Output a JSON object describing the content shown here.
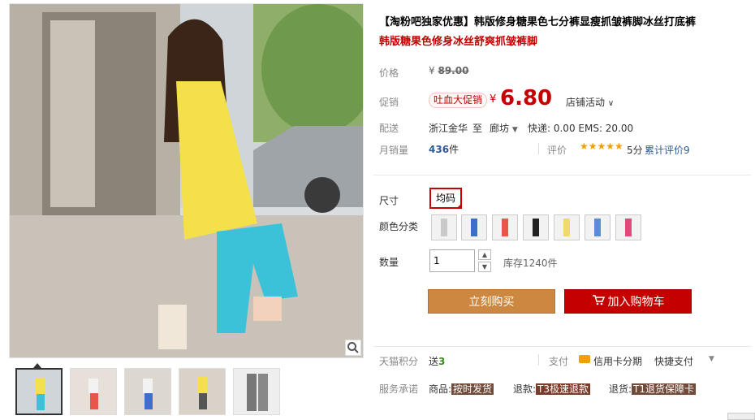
{
  "product": {
    "title": "【淘粉吧独家优惠】韩版修身糖果色七分裤显瘦抓皱裤脚冰丝打底裤",
    "subtitle": "韩版糖果色修身冰丝舒爽抓皱裤脚"
  },
  "price": {
    "label": "价格",
    "currency": "¥",
    "original": "89.00",
    "promo_label": "促销",
    "promo_badge": "吐血大促销",
    "promo_price": "6.80",
    "store_activity": "店铺活动"
  },
  "shipping": {
    "label": "配送",
    "from": "浙江金华",
    "to_word": "至",
    "to": "廊坊",
    "info": "快递: 0.00 EMS: 20.00"
  },
  "sales": {
    "label": "月销量",
    "count": "436",
    "unit": "件",
    "rating_label": "评价",
    "stars": "★★★★★",
    "score": "5分",
    "reviews": "累计评价9"
  },
  "size": {
    "label": "尺寸",
    "value": "均码"
  },
  "color": {
    "label": "颜色分类",
    "swatches": [
      "#c9c9c9",
      "#3b6fc9",
      "#e8554a",
      "#222222",
      "#f0d96a",
      "#5a8ad8",
      "#e04a7a"
    ]
  },
  "quantity": {
    "label": "数量",
    "value": "1",
    "stock": "库存1240件"
  },
  "buttons": {
    "buy": "立刻购买",
    "cart": "加入购物车"
  },
  "points": {
    "label": "天猫积分",
    "send": "送",
    "amount": "3",
    "pay_label": "支付",
    "credit": "信用卡分期",
    "quick": "快捷支付"
  },
  "service": {
    "label": "服务承诺",
    "goods": "商品:",
    "goods_tag": "按时发货",
    "refund": "退款:",
    "refund_tag": "T3极速退款",
    "return": "退货:",
    "return_tag": "T1退货保障卡"
  },
  "colors": {
    "accent_red": "#c40000",
    "buy_orange": "#cc8740"
  }
}
